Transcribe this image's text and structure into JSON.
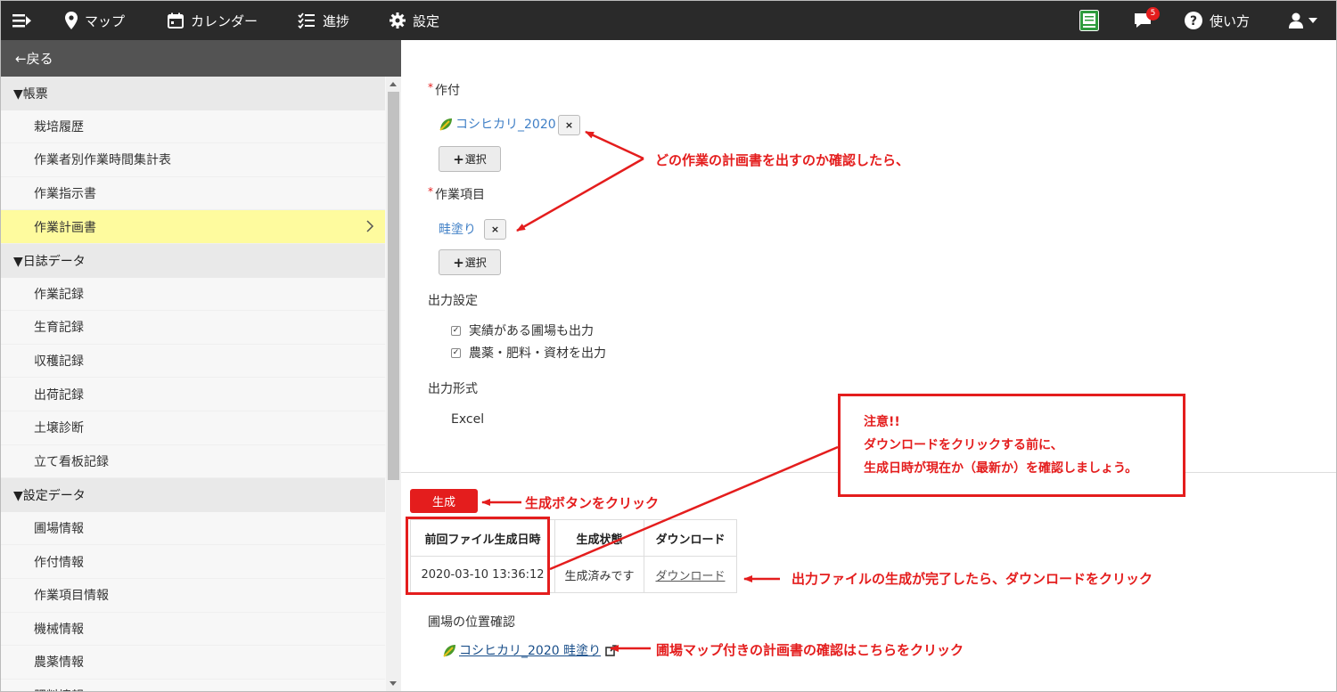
{
  "topnav": {
    "items": [
      {
        "label": "マップ",
        "icon": "map-pin-icon"
      },
      {
        "label": "カレンダー",
        "icon": "calendar-icon"
      },
      {
        "label": "進捗",
        "icon": "checklist-icon"
      },
      {
        "label": "設定",
        "icon": "gear-icon"
      }
    ],
    "notification_count": "5",
    "help_label": "使い方"
  },
  "sidebar": {
    "back_label": "←戻る",
    "sections": [
      {
        "label": "▼帳票",
        "items": [
          "栽培履歴",
          "作業者別作業時間集計表",
          "作業指示書",
          "作業計画書"
        ]
      },
      {
        "label": "▼日誌データ",
        "items": [
          "作業記録",
          "生育記録",
          "収穫記録",
          "出荷記録",
          "土壌診断",
          "立て看板記録"
        ]
      },
      {
        "label": "▼設定データ",
        "items": [
          "圃場情報",
          "作付情報",
          "作業項目情報",
          "機械情報",
          "農薬情報",
          "肥料情報"
        ]
      }
    ],
    "active_item": "作業計画書"
  },
  "form": {
    "crop_label": "作付",
    "crop_value": "コシヒカリ_2020",
    "remove_label": "×",
    "select_label": "選択",
    "task_label": "作業項目",
    "task_value": "畦塗り",
    "output_settings_label": "出力設定",
    "checkbox_1": "実績がある圃場も出力",
    "checkbox_2": "農薬・肥料・資材を出力",
    "format_label": "出力形式",
    "format_value": "Excel"
  },
  "generate_button": "生成",
  "output_table": {
    "headers": [
      "前回ファイル生成日時",
      "生成状態",
      "ダウンロード"
    ],
    "row": [
      "2020-03-10 13:36:12",
      "生成済みです",
      "ダウンロード"
    ]
  },
  "location": {
    "label": "圃場の位置確認",
    "link": "コシヒカリ_2020 畦塗り"
  },
  "annotations": {
    "which_work": "どの作業の計画書を出すのか確認したら、",
    "note_line1": "注意!!",
    "note_line2": "ダウンロードをクリックする前に、",
    "note_line3": "生成日時が現在か（最新か）を確認しましょう。",
    "generate_hint": "生成ボタンをクリック",
    "download_hint": "出力ファイルの生成が完了したら、ダウンロードをクリック",
    "map_hint": "圃場マップ付きの計画書の確認はこちらをクリック"
  },
  "colors": {
    "nav_bg": "#2a2a2a",
    "accent_red": "#e41d1d",
    "link_blue": "#3f7fc6",
    "active_bg": "#fefb9e"
  }
}
